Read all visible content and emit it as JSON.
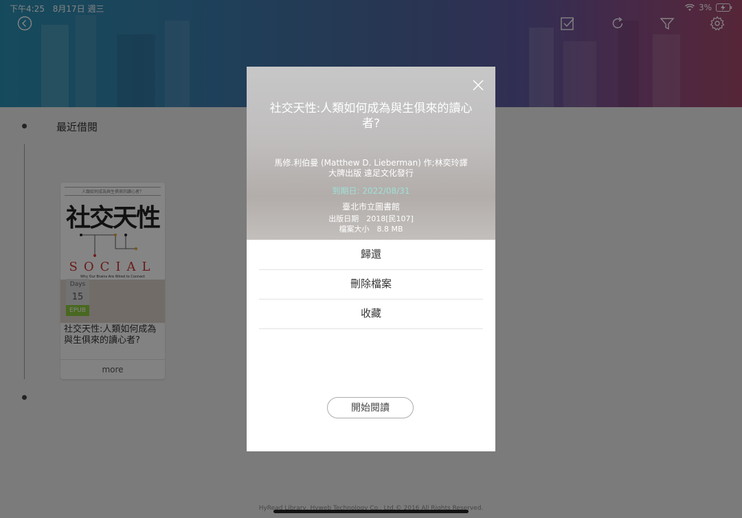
{
  "status_bar": {
    "time": "下午4:25",
    "date": "8月17日 週三",
    "battery": "3%"
  },
  "header": {
    "icons": [
      "back-icon",
      "select-checkbox-icon",
      "refresh-icon",
      "filter-icon",
      "settings-icon"
    ]
  },
  "section": {
    "title": "最近借閱"
  },
  "book": {
    "cover_top_line": "人類如何成為與生俱來的讀心者？",
    "cover_title": "社交天性",
    "cover_social": "SOCIAL",
    "cover_subtitle": "Why Our Brains Are Wired to Connect",
    "days_label": "Days",
    "days_value": "15",
    "format": "EPUB",
    "title": "社交天性:人類如何成為與生俱來的讀心者?",
    "more_label": "more"
  },
  "modal": {
    "title": "社交天性:人類如何成為與生俱來的讀心者?",
    "author": "馬修.利伯曼 (Matthew D. Lieberman) 作;林奕玲譯",
    "publisher": "大牌出版 遠足文化發行",
    "due_date": "到期日: 2022/08/31",
    "library": "臺北市立圖書館",
    "pub_date": "出版日期　2018[民107]",
    "file_size": "檔案大小　8.8 MB",
    "actions": [
      "歸還",
      "刪除檔案",
      "收藏"
    ],
    "read_button": "開始閱讀"
  },
  "footer": {
    "text": "HyRead Library, Hyweb Technology Co., Ltd.© 2016 All Rights Reserved."
  },
  "colors": {
    "due_date": "#9fe0d6",
    "format_badge": "#8dc73f"
  }
}
